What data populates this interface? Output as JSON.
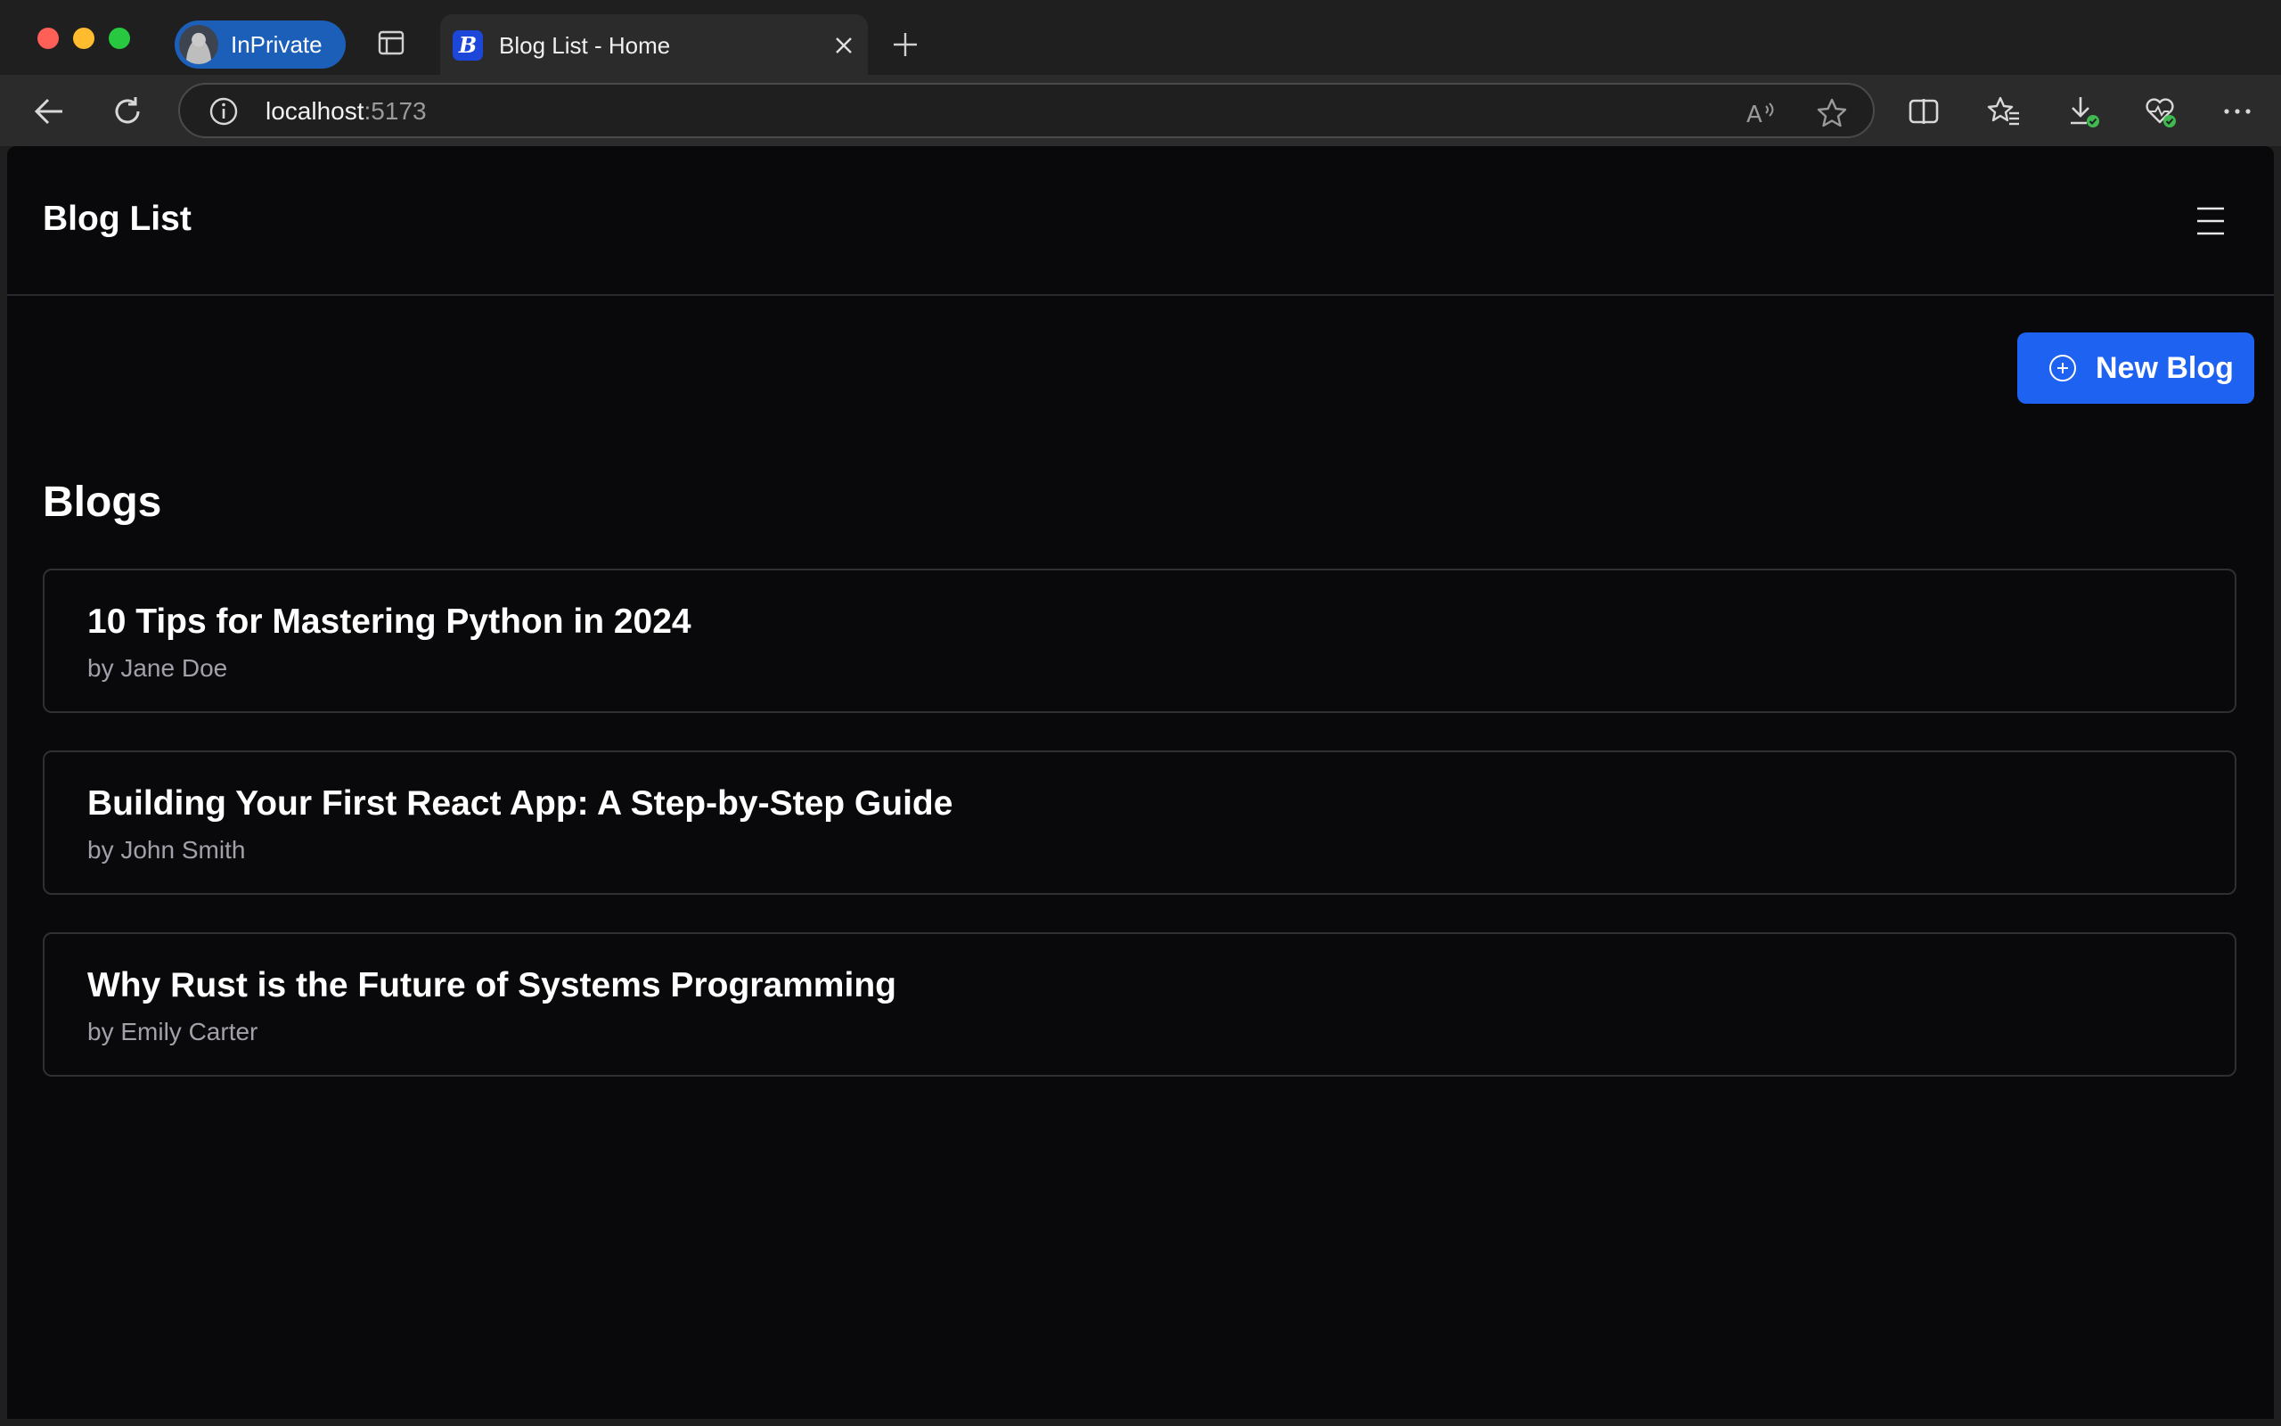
{
  "browser": {
    "profile_label": "InPrivate",
    "tab": {
      "title": "Blog List - Home",
      "favicon_letter": "B"
    },
    "address": {
      "host": "localhost",
      "port": ":5173"
    }
  },
  "app": {
    "brand": "Blog List",
    "new_blog_label": "New Blog",
    "section_title": "Blogs",
    "accent_color": "#1d62f0",
    "blogs": [
      {
        "title": "10 Tips for Mastering Python in 2024",
        "author": "by Jane Doe"
      },
      {
        "title": "Building Your First React App: A Step-by-Step Guide",
        "author": "by John Smith"
      },
      {
        "title": "Why Rust is the Future of Systems Programming",
        "author": "by Emily Carter"
      }
    ]
  }
}
